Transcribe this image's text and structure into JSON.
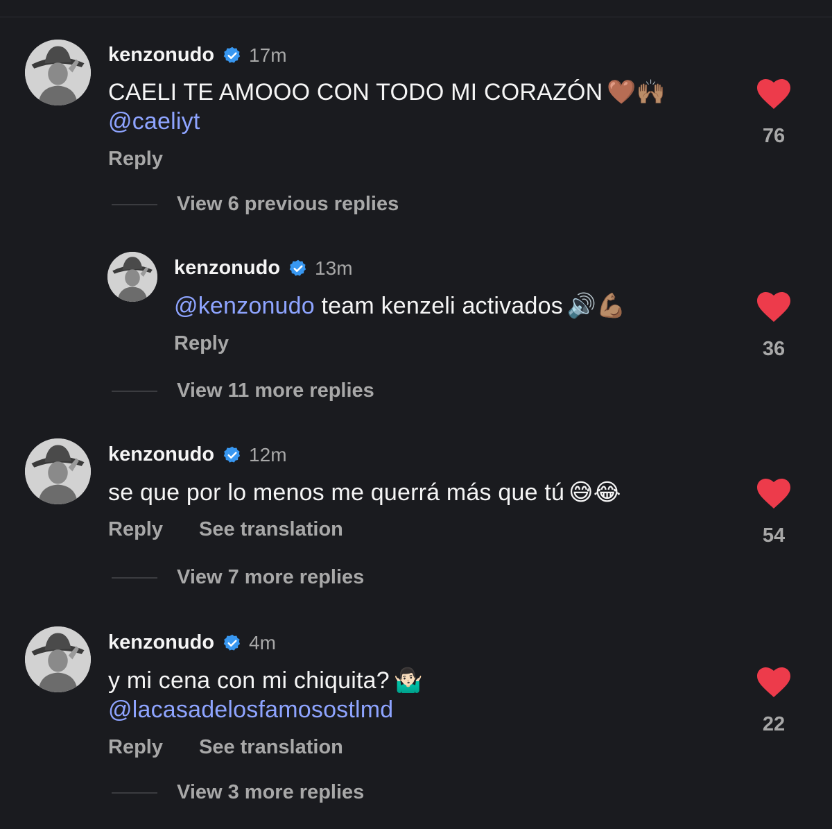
{
  "colors": {
    "background": "#1a1b1f",
    "text": "#f5f5f5",
    "muted": "#a8a8a8",
    "mention": "#8ea4ff",
    "verified": "#3897f0",
    "heart": "#ed3b4b"
  },
  "comments": [
    {
      "username": "kenzonudo",
      "time": "17m",
      "line1": "CAELI TE AMOOO CON TODO MI CORAZÓN",
      "line1_emoji": "🤎🙌🏽",
      "mention": "@caeliyt",
      "reply_label": "Reply",
      "likes": "76",
      "view_replies": "View 6 previous replies"
    },
    {
      "username": "kenzonudo",
      "time": "13m",
      "mention": "@kenzonudo",
      "text": " team kenzeli activados",
      "emoji": "🔊💪🏽",
      "reply_label": "Reply",
      "likes": "36",
      "view_replies": "View 11 more replies"
    },
    {
      "username": "kenzonudo",
      "time": "12m",
      "text": "se que por lo menos me querrá más que tú",
      "emoji": "😅😂",
      "reply_label": "Reply",
      "translate_label": "See translation",
      "likes": "54",
      "view_replies": "View 7 more replies"
    },
    {
      "username": "kenzonudo",
      "time": "4m",
      "text": "y mi cena con mi chiquita?",
      "emoji": "🤷🏻‍♂️",
      "mention": "@lacasadelosfamosostlmd",
      "reply_label": "Reply",
      "translate_label": "See translation",
      "likes": "22",
      "view_replies": "View 3 more replies"
    }
  ]
}
